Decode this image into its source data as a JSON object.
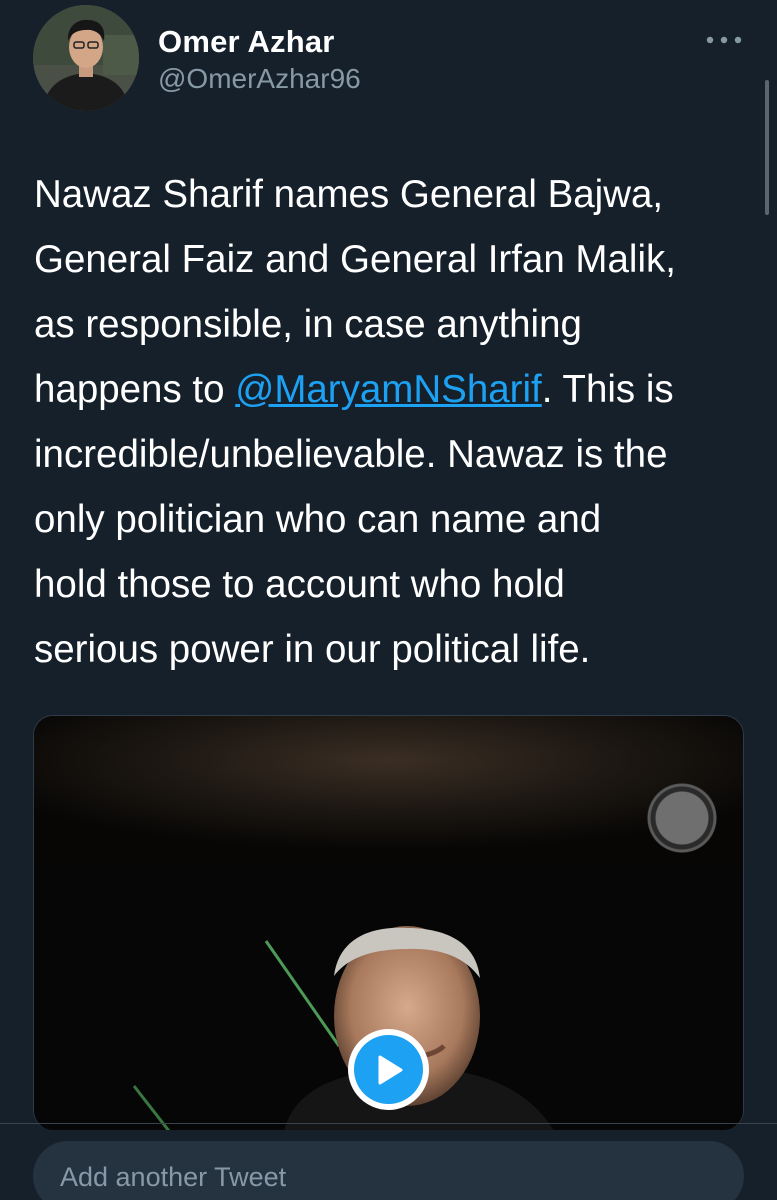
{
  "tweet": {
    "author_name": "Omer Azhar",
    "author_handle": "@OmerAzhar96",
    "text_before_mention": "Nawaz Sharif names General Bajwa,\nGeneral Faiz and General Irfan Malik,\nas responsible, in case anything\nhappens to ",
    "mention": "@MaryamNSharif",
    "text_after_mention": ". This is\nincredible/unbelievable. Nawaz is the\nonly politician who can name and\nhold those to account who hold\nserious power in our political life."
  },
  "composer": {
    "placeholder": "Add another Tweet"
  },
  "icons": {
    "more": "more-options-icon",
    "play": "play-icon",
    "record": "record-icon"
  },
  "colors": {
    "background": "#15202b",
    "accent": "#1da1f2",
    "secondary_text": "#8899a6",
    "input_background": "#253341"
  }
}
